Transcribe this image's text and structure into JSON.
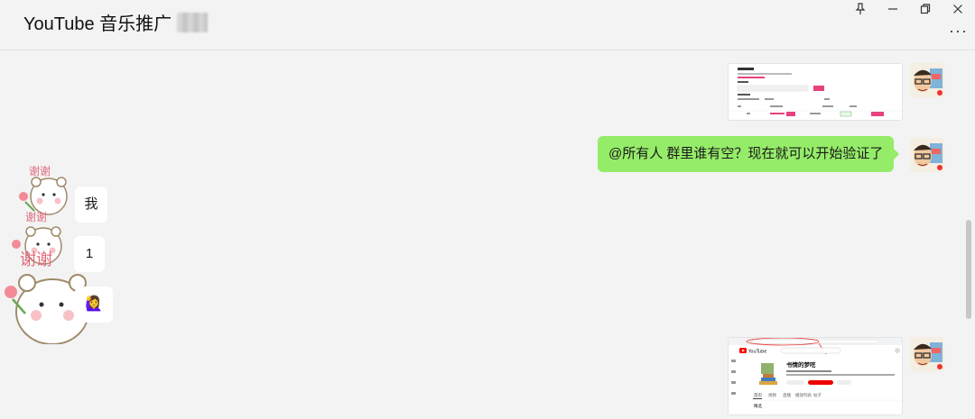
{
  "header": {
    "title": "YouTube 音乐推广",
    "pin_icon": "pin-icon",
    "minimize_icon": "minimize-icon",
    "restore_icon": "restore-icon",
    "close_icon": "close-icon",
    "more_icon": "more-options-icon",
    "more_label": "···"
  },
  "messages": {
    "outgoing_text": "@所有人 群里谁有空？现在就可以开始验证了",
    "incoming_1": "我",
    "incoming_2": "1",
    "incoming_3_emoji": "🙋‍♀️",
    "sticker_caption": "谢谢"
  },
  "youtube_shot": {
    "brand": "YouTube",
    "channel_name": "书情的梦呓",
    "tabs": [
      "首页",
      "视频",
      "直播",
      "播放列表",
      "帖子"
    ],
    "search_label": "搜索",
    "section_label": "精选"
  },
  "colors": {
    "own_bubble": "#95ec69",
    "other_bubble": "#ffffff",
    "background": "#f3f3f3",
    "accent_red": "#ff0000",
    "pink": "#e8417f"
  }
}
